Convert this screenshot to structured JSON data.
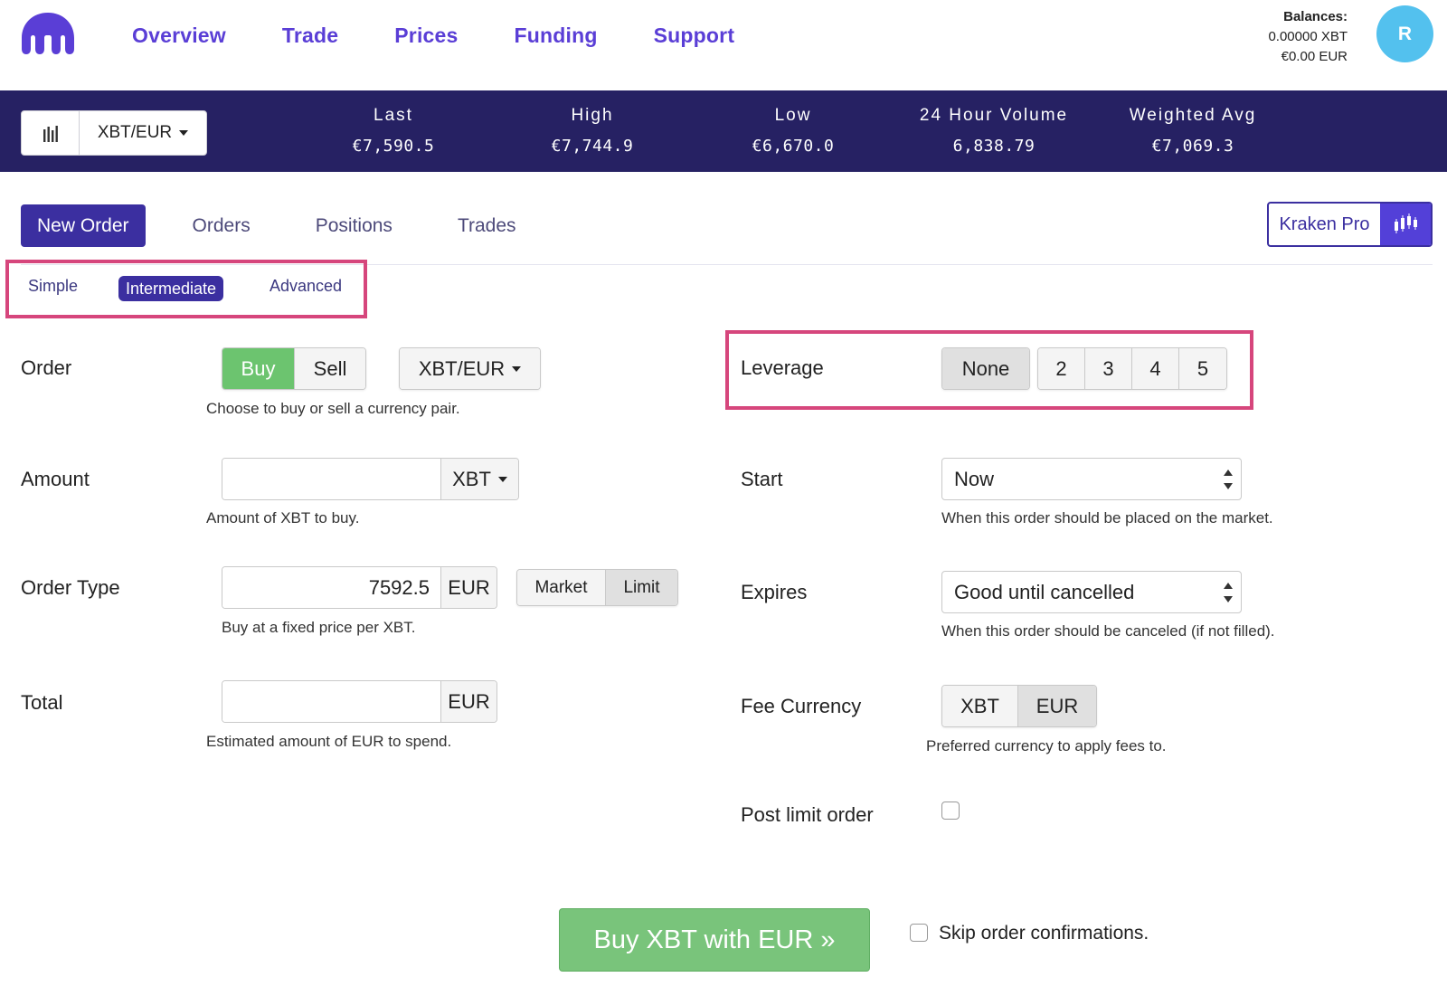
{
  "nav": {
    "items": [
      "Overview",
      "Trade",
      "Prices",
      "Funding",
      "Support"
    ]
  },
  "balances": {
    "title": "Balances:",
    "xbt": "͹0.00000 XBT",
    "eur": "€0.00 EUR"
  },
  "avatar": {
    "initial": "R"
  },
  "ticker": {
    "pair": "XBT/EUR",
    "stats": [
      {
        "label": "Last",
        "value": "€7,590.5"
      },
      {
        "label": "High",
        "value": "€7,744.9"
      },
      {
        "label": "Low",
        "value": "€6,670.0"
      },
      {
        "label": "24 Hour Volume",
        "value": "6,838.79"
      },
      {
        "label": "Weighted Avg",
        "value": "€7,069.3"
      }
    ]
  },
  "tabs": [
    "New Order",
    "Orders",
    "Positions",
    "Trades"
  ],
  "kraken_pro": {
    "label": "Kraken Pro"
  },
  "modes": [
    "Simple",
    "Intermediate",
    "Advanced"
  ],
  "form": {
    "order": {
      "label": "Order",
      "buy": "Buy",
      "sell": "Sell",
      "pair": "XBT/EUR",
      "help": "Choose to buy or sell a currency pair."
    },
    "amount": {
      "label": "Amount",
      "value": "",
      "unit": "XBT",
      "help": "Amount of XBT to buy."
    },
    "order_type": {
      "label": "Order Type",
      "value": "7592.5",
      "unit": "EUR",
      "market": "Market",
      "limit": "Limit",
      "help": "Buy at a fixed price per XBT."
    },
    "total": {
      "label": "Total",
      "value": "",
      "unit": "EUR",
      "help": "Estimated amount of EUR to spend."
    },
    "leverage": {
      "label": "Leverage",
      "none": "None",
      "options": [
        "2",
        "3",
        "4",
        "5"
      ]
    },
    "start": {
      "label": "Start",
      "value": "Now",
      "help": "When this order should be placed on the market."
    },
    "expires": {
      "label": "Expires",
      "value": "Good until cancelled",
      "help": "When this order should be canceled (if not filled)."
    },
    "fee_currency": {
      "label": "Fee Currency",
      "xbt": "XBT",
      "eur": "EUR",
      "help": "Preferred currency to apply fees to."
    },
    "post_limit": {
      "label": "Post limit order"
    }
  },
  "submit": {
    "label": "Buy XBT with EUR »",
    "skip_label": "Skip order confirmations."
  },
  "colors": {
    "brand": "#5a3ed6",
    "ticker_bg": "#262163",
    "active_tab": "#3b2fa0",
    "buy_green": "#6cc46f",
    "highlight": "#d6467c",
    "avatar": "#53c1ee"
  }
}
